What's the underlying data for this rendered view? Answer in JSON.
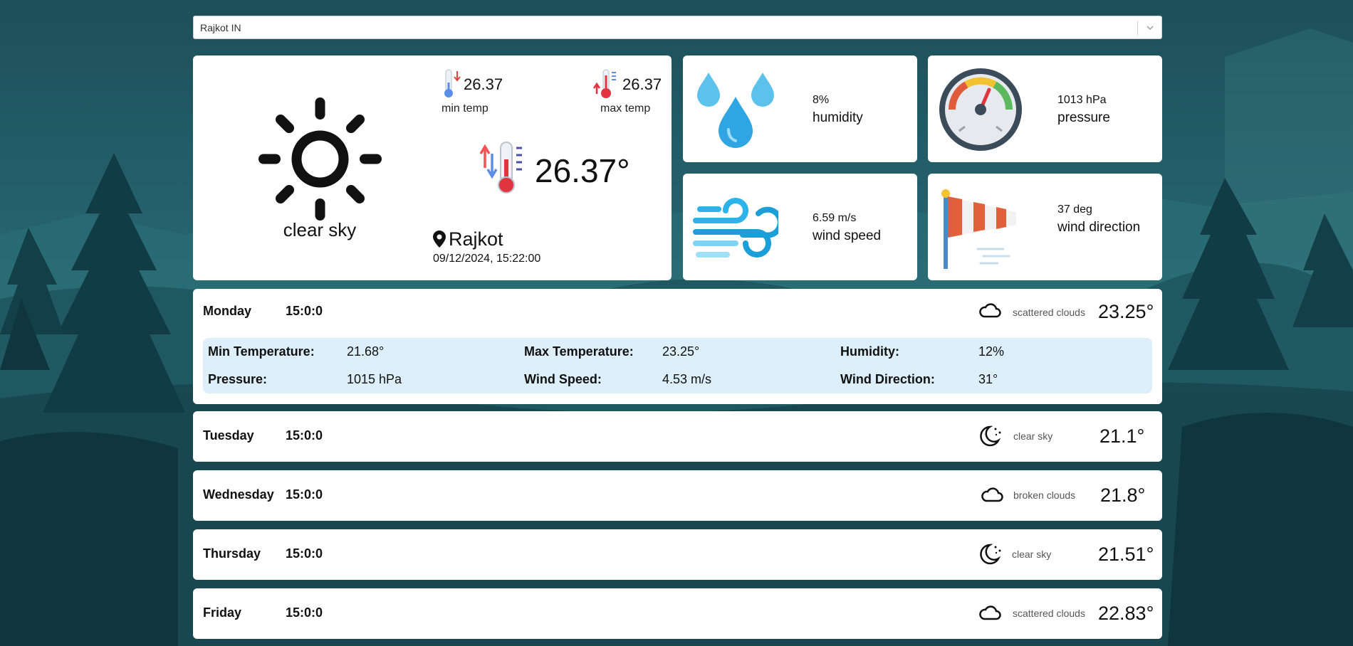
{
  "search": {
    "value": "Rajkot IN"
  },
  "current": {
    "condition": "clear sky",
    "min_temp": "26.37",
    "min_temp_label": "min temp",
    "max_temp": "26.37",
    "max_temp_label": "max temp",
    "temp": "26.37°",
    "city": "Rajkot",
    "datetime": "09/12/2024, 15:22:00"
  },
  "stats": {
    "humidity": {
      "value": "8%",
      "label": "humidity"
    },
    "pressure": {
      "value": "1013 hPa",
      "label": "pressure"
    },
    "wind_speed": {
      "value": "6.59 m/s",
      "label": "wind speed"
    },
    "wind_direction": {
      "value": "37 deg",
      "label": "wind direction"
    }
  },
  "forecast": [
    {
      "day": "Monday",
      "time": "15:0:0",
      "icon": "cloud-icon",
      "desc": "scattered clouds",
      "temp": "23.25°",
      "expanded": true,
      "details": {
        "min_label": "Min Temperature:",
        "min_value": "21.68°",
        "max_label": "Max Temperature:",
        "max_value": "23.25°",
        "humidity_label": "Humidity:",
        "humidity_value": "12%",
        "pressure_label": "Pressure:",
        "pressure_value": "1015 hPa",
        "wind_speed_label": "Wind Speed:",
        "wind_speed_value": "4.53 m/s",
        "wind_dir_label": "Wind Direction:",
        "wind_dir_value": "31°"
      }
    },
    {
      "day": "Tuesday",
      "time": "15:0:0",
      "icon": "moon-icon",
      "desc": "clear sky",
      "temp": "21.1°"
    },
    {
      "day": "Wednesday",
      "time": "15:0:0",
      "icon": "cloud-icon",
      "desc": "broken clouds",
      "temp": "21.8°"
    },
    {
      "day": "Thursday",
      "time": "15:0:0",
      "icon": "moon-icon",
      "desc": "clear sky",
      "temp": "21.51°"
    },
    {
      "day": "Friday",
      "time": "15:0:0",
      "icon": "cloud-icon",
      "desc": "scattered clouds",
      "temp": "22.83°"
    }
  ]
}
